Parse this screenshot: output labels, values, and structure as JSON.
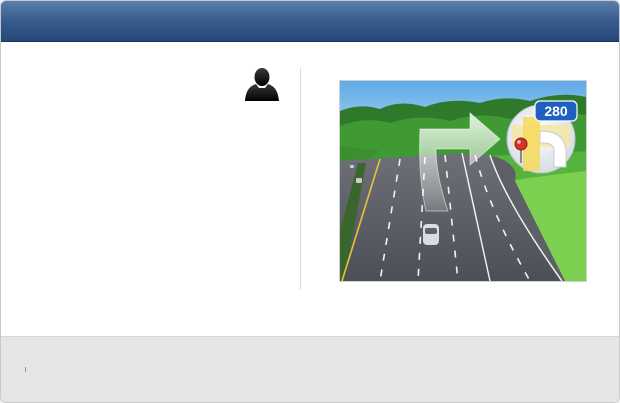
{
  "header": {
    "title": ""
  },
  "profile": {
    "icon": "user-silhouette-icon"
  },
  "promo": {
    "image": "highway-navigation-photo",
    "sign_number": "280",
    "icons": [
      "turn-arrow-icon",
      "maps-app-icon",
      "map-pin-icon"
    ]
  },
  "footer": {
    "text": ""
  },
  "colors": {
    "header_top": "#5a7fae",
    "header_bottom": "#26467a",
    "footer_bg": "#e6e6e6",
    "highway_sign": "#1f5fbf",
    "pin": "#d6312b"
  }
}
